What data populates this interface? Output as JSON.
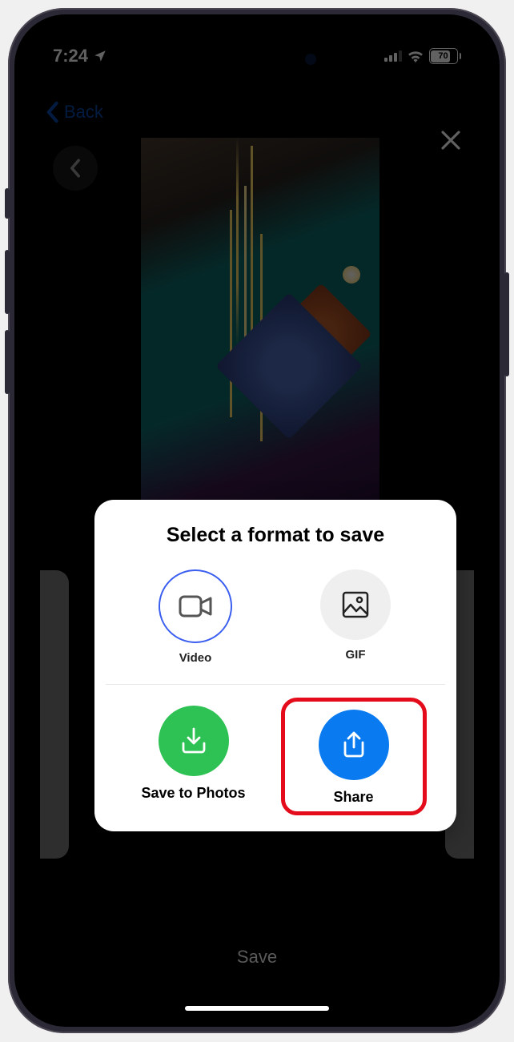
{
  "status": {
    "time": "7:24",
    "battery_pct": "70"
  },
  "nav": {
    "back_label": "Back"
  },
  "bottom": {
    "save_label": "Save"
  },
  "modal": {
    "title": "Select a format to save",
    "formats": {
      "video": "Video",
      "gif": "GIF"
    },
    "actions": {
      "save": "Save to Photos",
      "share": "Share"
    }
  }
}
